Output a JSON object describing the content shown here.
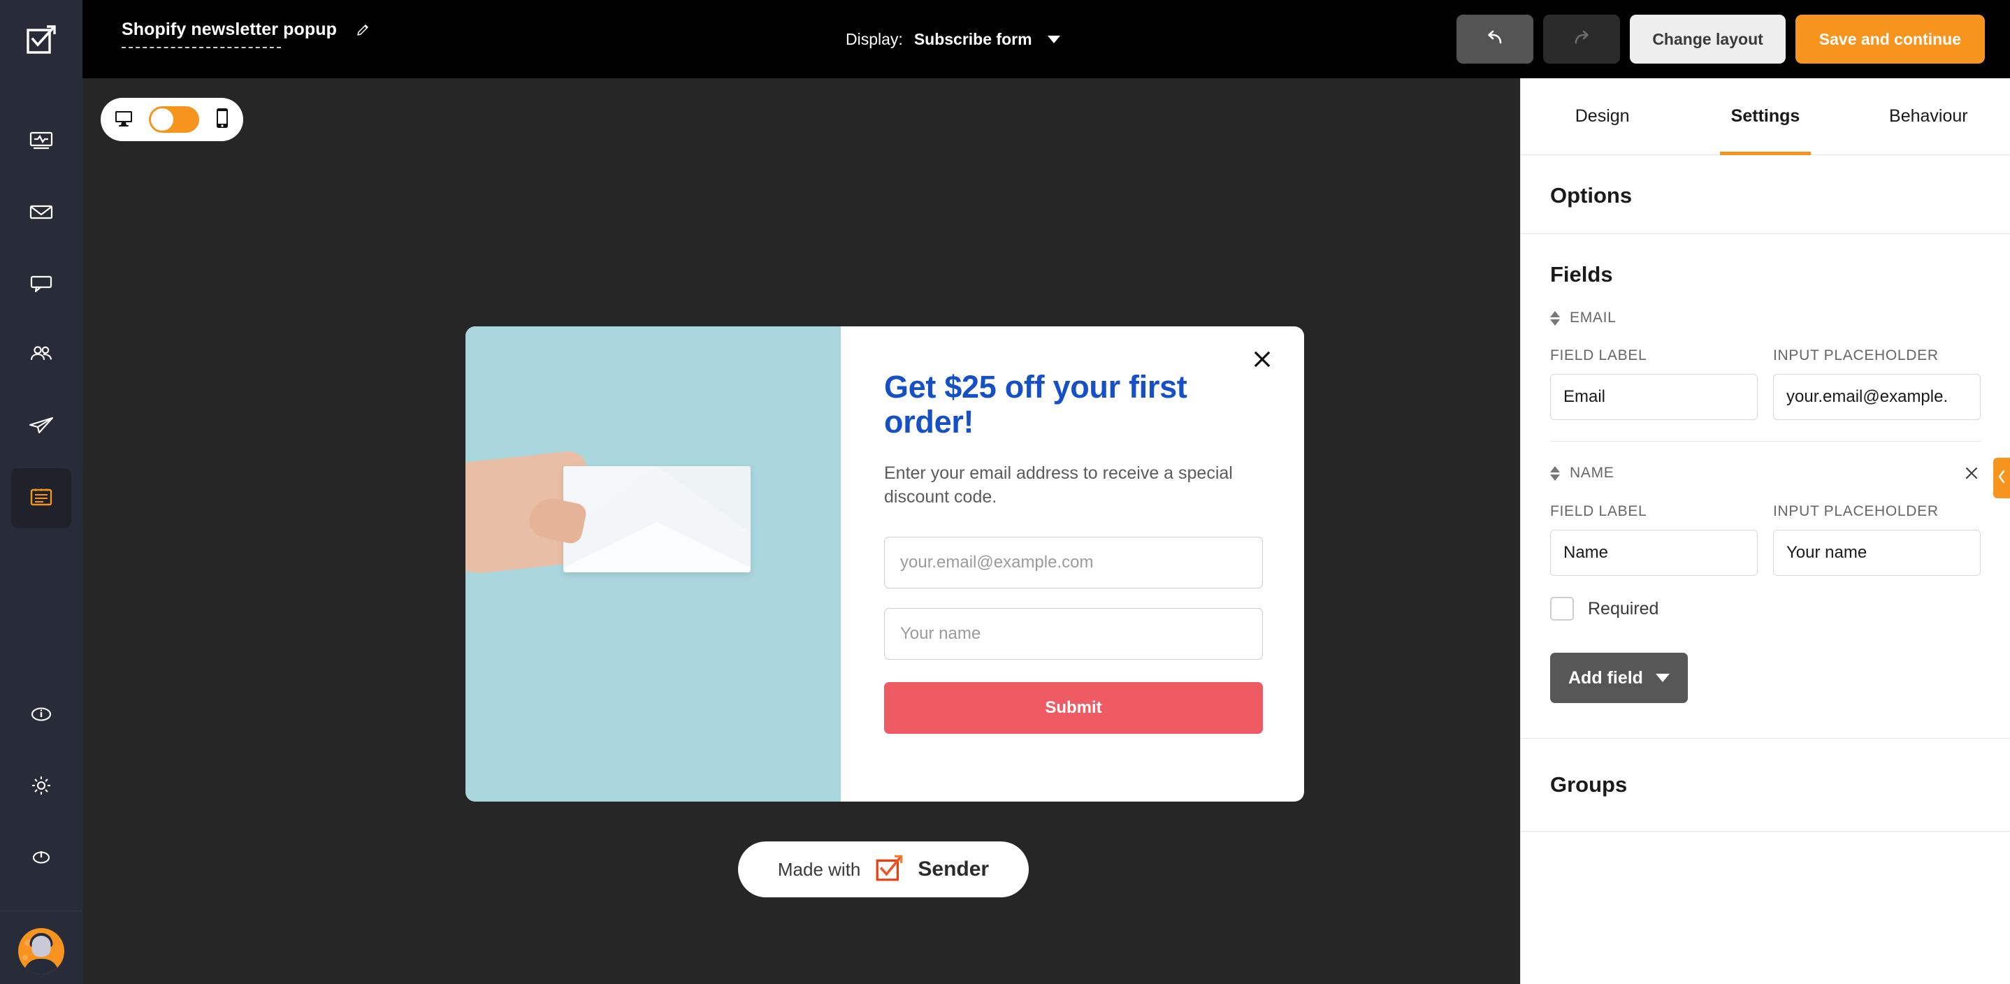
{
  "topbar": {
    "doc_title": "Shopify newsletter popup",
    "edit_icon": "pencil-icon",
    "display_label": "Display:",
    "display_value": "Subscribe form",
    "undo_icon": "undo-icon",
    "redo_icon": "redo-icon",
    "change_layout_label": "Change layout",
    "save_label": "Save and continue",
    "accent_orange": "#f7941e",
    "background": "#000000"
  },
  "sidebar": {
    "logo_icon": "sender-logo-icon",
    "background": "#272c38",
    "items": [
      {
        "icon": "dashboard-icon",
        "active": false
      },
      {
        "icon": "envelope-icon",
        "active": false
      },
      {
        "icon": "chat-bubble-icon",
        "active": false
      },
      {
        "icon": "audience-icon",
        "active": false
      },
      {
        "icon": "paper-plane-icon",
        "active": false
      },
      {
        "icon": "forms-icon",
        "active": true
      }
    ],
    "bottom_items": [
      {
        "icon": "info-icon"
      },
      {
        "icon": "gear-icon"
      },
      {
        "icon": "power-icon"
      }
    ],
    "avatar": "user-avatar"
  },
  "canvas": {
    "background": "#262626",
    "device_toggle": {
      "desktop_icon": "desktop-monitor-icon",
      "mobile_icon": "mobile-phone-icon",
      "state": "desktop",
      "accent": "#f7941e"
    },
    "popup": {
      "close_icon": "close-x-icon",
      "image_alt": "hand-holding-envelope",
      "image_background": "#a9d6dc",
      "headline": "Get $25 off your first order!",
      "headline_color": "#1550c7",
      "subtext": "Enter your email address to receive a special discount code.",
      "email_placeholder": "your.email@example.com",
      "name_placeholder": "Your name",
      "submit_label": "Submit",
      "submit_color": "#ef5b62"
    },
    "badge": {
      "made_with": "Made with",
      "brand": "Sender",
      "logo_icon": "sender-logo-icon"
    }
  },
  "panel": {
    "tabs": [
      {
        "label": "Design",
        "active": false
      },
      {
        "label": "Settings",
        "active": true
      },
      {
        "label": "Behaviour",
        "active": false
      }
    ],
    "options_title": "Options",
    "fields_title": "Fields",
    "col_label_field": "FIELD LABEL",
    "col_label_placeholder": "INPUT PLACEHOLDER",
    "fields": [
      {
        "key": "EMAIL",
        "sort_icon": "sort-handle-icon",
        "removable": false,
        "field_label": "Email",
        "input_placeholder": "your.email@example.",
        "has_required": false
      },
      {
        "key": "NAME",
        "sort_icon": "sort-handle-icon",
        "removable": true,
        "remove_icon": "close-x-icon",
        "field_label": "Name",
        "input_placeholder": "Your name",
        "has_required": true,
        "required_label": "Required",
        "required_checked": false
      }
    ],
    "add_field_label": "Add field",
    "add_field_icon": "chevron-down-icon",
    "groups_title": "Groups",
    "collapse_icon": "chevron-left-icon",
    "collapse_color": "#f7941e"
  }
}
